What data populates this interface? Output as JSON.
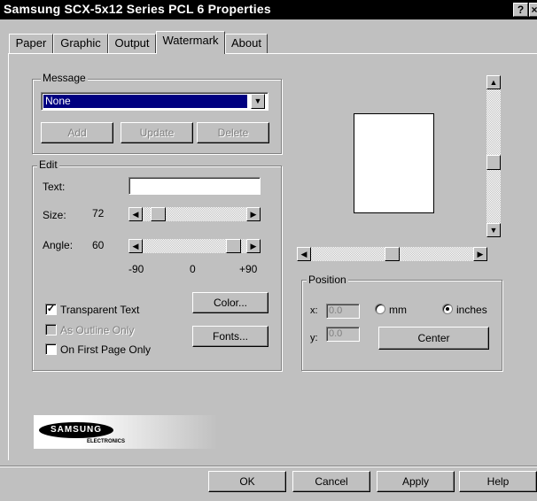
{
  "window": {
    "title": "Samsung SCX-5x12 Series PCL 6 Properties",
    "help_button": "?",
    "close_button": "×"
  },
  "tabs": [
    {
      "label": "Paper",
      "active": false
    },
    {
      "label": "Graphic",
      "active": false
    },
    {
      "label": "Output",
      "active": false
    },
    {
      "label": "Watermark",
      "active": true
    },
    {
      "label": "About",
      "active": false
    }
  ],
  "message": {
    "group_label": "Message",
    "selected": "None",
    "add_label": "Add",
    "update_label": "Update",
    "delete_label": "Delete"
  },
  "edit": {
    "group_label": "Edit",
    "text_label": "Text:",
    "text_value": "",
    "size_label": "Size:",
    "size_value": "72",
    "angle_label": "Angle:",
    "angle_value": "60",
    "angle_min": "-90",
    "angle_mid": "0",
    "angle_max": "+90",
    "transparent_text": "Transparent Text",
    "transparent_checked": true,
    "outline_only": "As Outline Only",
    "outline_checked": false,
    "first_page_only": "On First Page Only",
    "first_page_checked": false,
    "color_label": "Color...",
    "fonts_label": "Fonts..."
  },
  "position": {
    "group_label": "Position",
    "x_label": "x:",
    "x_value": "0.0",
    "y_label": "y:",
    "y_value": "0.0",
    "mm_label": "mm",
    "inches_label": "inches",
    "unit_selected": "inches",
    "center_label": "Center"
  },
  "brand": {
    "logo_text": "SAMSUNG",
    "sub_text": "ELECTRONICS"
  },
  "footer": {
    "ok_label": "OK",
    "cancel_label": "Cancel",
    "apply_label": "Apply",
    "help_label": "Help"
  }
}
